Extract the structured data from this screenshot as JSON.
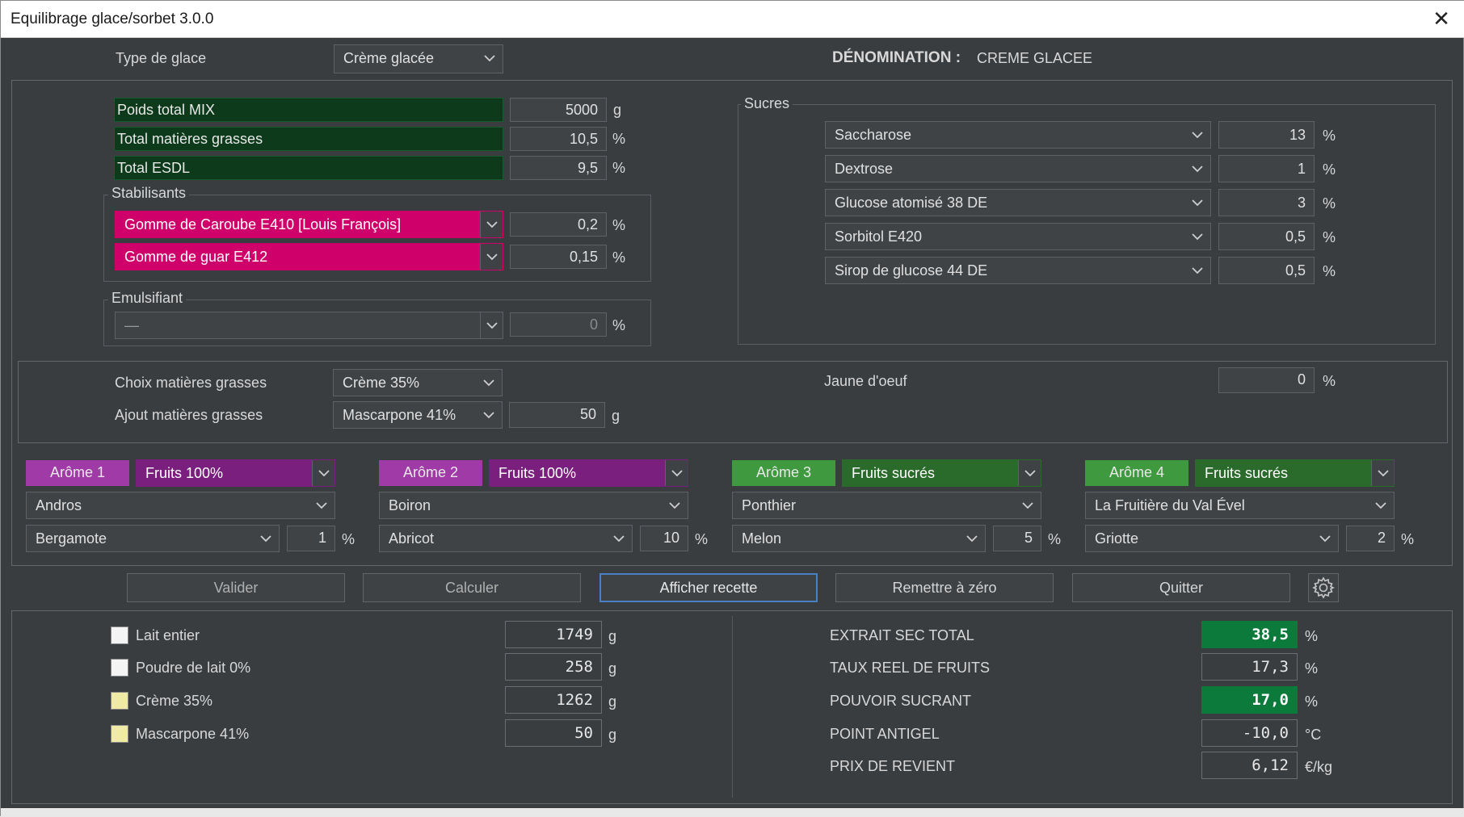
{
  "window": {
    "title": "Equilibrage glace/sorbet 3.0.0",
    "close_label": "✕"
  },
  "header": {
    "type_label": "Type de glace",
    "type_value": "Crème glacée",
    "denomination_label": "DÉNOMINATION :",
    "denomination_value": "CREME GLACEE"
  },
  "mix": {
    "poids_label": "Poids total MIX",
    "poids_value": "5000",
    "poids_unit": "g",
    "mg_label": "Total matières grasses",
    "mg_value": "10,5",
    "mg_unit": "%",
    "esdl_label": "Total ESDL",
    "esdl_value": "9,5",
    "esdl_unit": "%"
  },
  "stabilisants": {
    "title": "Stabilisants",
    "items": [
      {
        "name": "Gomme de Caroube E410 [Louis François]",
        "value": "0,2",
        "unit": "%"
      },
      {
        "name": "Gomme de guar E412",
        "value": "0,15",
        "unit": "%"
      }
    ],
    "color": "#d0006a"
  },
  "emulsifiant": {
    "title": "Emulsifiant",
    "name": "—",
    "value": "0",
    "unit": "%"
  },
  "sucres": {
    "title": "Sucres",
    "items": [
      {
        "name": "Saccharose",
        "value": "13",
        "unit": "%"
      },
      {
        "name": "Dextrose",
        "value": "1",
        "unit": "%"
      },
      {
        "name": "Glucose atomisé 38 DE",
        "value": "3",
        "unit": "%"
      },
      {
        "name": "Sorbitol E420",
        "value": "0,5",
        "unit": "%"
      },
      {
        "name": "Sirop de glucose 44 DE",
        "value": "0,5",
        "unit": "%"
      }
    ]
  },
  "fats": {
    "choix_label": "Choix matières grasses",
    "choix_value": "Crème 35%",
    "ajout_label": "Ajout matières grasses",
    "ajout_value": "Mascarpone 41%",
    "ajout_qty": "50",
    "ajout_unit": "g",
    "jaune_label": "Jaune d'oeuf",
    "jaune_value": "0",
    "jaune_unit": "%"
  },
  "aromes": [
    {
      "badge": "Arôme 1",
      "type": "Fruits 100%",
      "brand": "Andros",
      "flavor": "Bergamote",
      "qty": "1",
      "unit": "%",
      "badge_color": "#a03aa6",
      "type_color": "#7a1f7e"
    },
    {
      "badge": "Arôme 2",
      "type": "Fruits 100%",
      "brand": "Boiron",
      "flavor": "Abricot",
      "qty": "10",
      "unit": "%",
      "badge_color": "#a03aa6",
      "type_color": "#7a1f7e"
    },
    {
      "badge": "Arôme 3",
      "type": "Fruits sucrés",
      "brand": "Ponthier",
      "flavor": "Melon",
      "qty": "5",
      "unit": "%",
      "badge_color": "#3f9a3f",
      "type_color": "#2a6a2a"
    },
    {
      "badge": "Arôme 4",
      "type": "Fruits sucrés",
      "brand": "La Fruitière du Val Ével",
      "flavor": "Griotte",
      "qty": "2",
      "unit": "%",
      "badge_color": "#3f9a3f",
      "type_color": "#2a6a2a"
    }
  ],
  "buttons": {
    "valider": "Valider",
    "calculer": "Calculer",
    "afficher": "Afficher recette",
    "reset": "Remettre à zéro",
    "quitter": "Quitter"
  },
  "recipe": [
    {
      "name": "Lait entier",
      "qty": "1749",
      "unit": "g",
      "color": "#f4f4f4"
    },
    {
      "name": "Poudre de lait 0%",
      "qty": "258",
      "unit": "g",
      "color": "#f4f4f4"
    },
    {
      "name": "Crème 35%",
      "qty": "1262",
      "unit": "g",
      "color": "#efeaa6"
    },
    {
      "name": "Mascarpone 41%",
      "qty": "50",
      "unit": "g",
      "color": "#efeaa6"
    }
  ],
  "results": [
    {
      "label": "EXTRAIT SEC TOTAL",
      "value": "38,5",
      "unit": "%",
      "highlight": true
    },
    {
      "label": "TAUX REEL DE FRUITS",
      "value": "17,3",
      "unit": "%",
      "highlight": false
    },
    {
      "label": "POUVOIR SUCRANT",
      "value": "17,0",
      "unit": "%",
      "highlight": true
    },
    {
      "label": "POINT ANTIGEL",
      "value": "-10,0",
      "unit": "°C",
      "highlight": false
    },
    {
      "label": "PRIX DE REVIENT",
      "value": "6,12",
      "unit": "€/kg",
      "highlight": false
    }
  ],
  "icons": {
    "settings": "gear-icon",
    "dropdown": "chevron-down-icon",
    "close": "close-icon"
  }
}
